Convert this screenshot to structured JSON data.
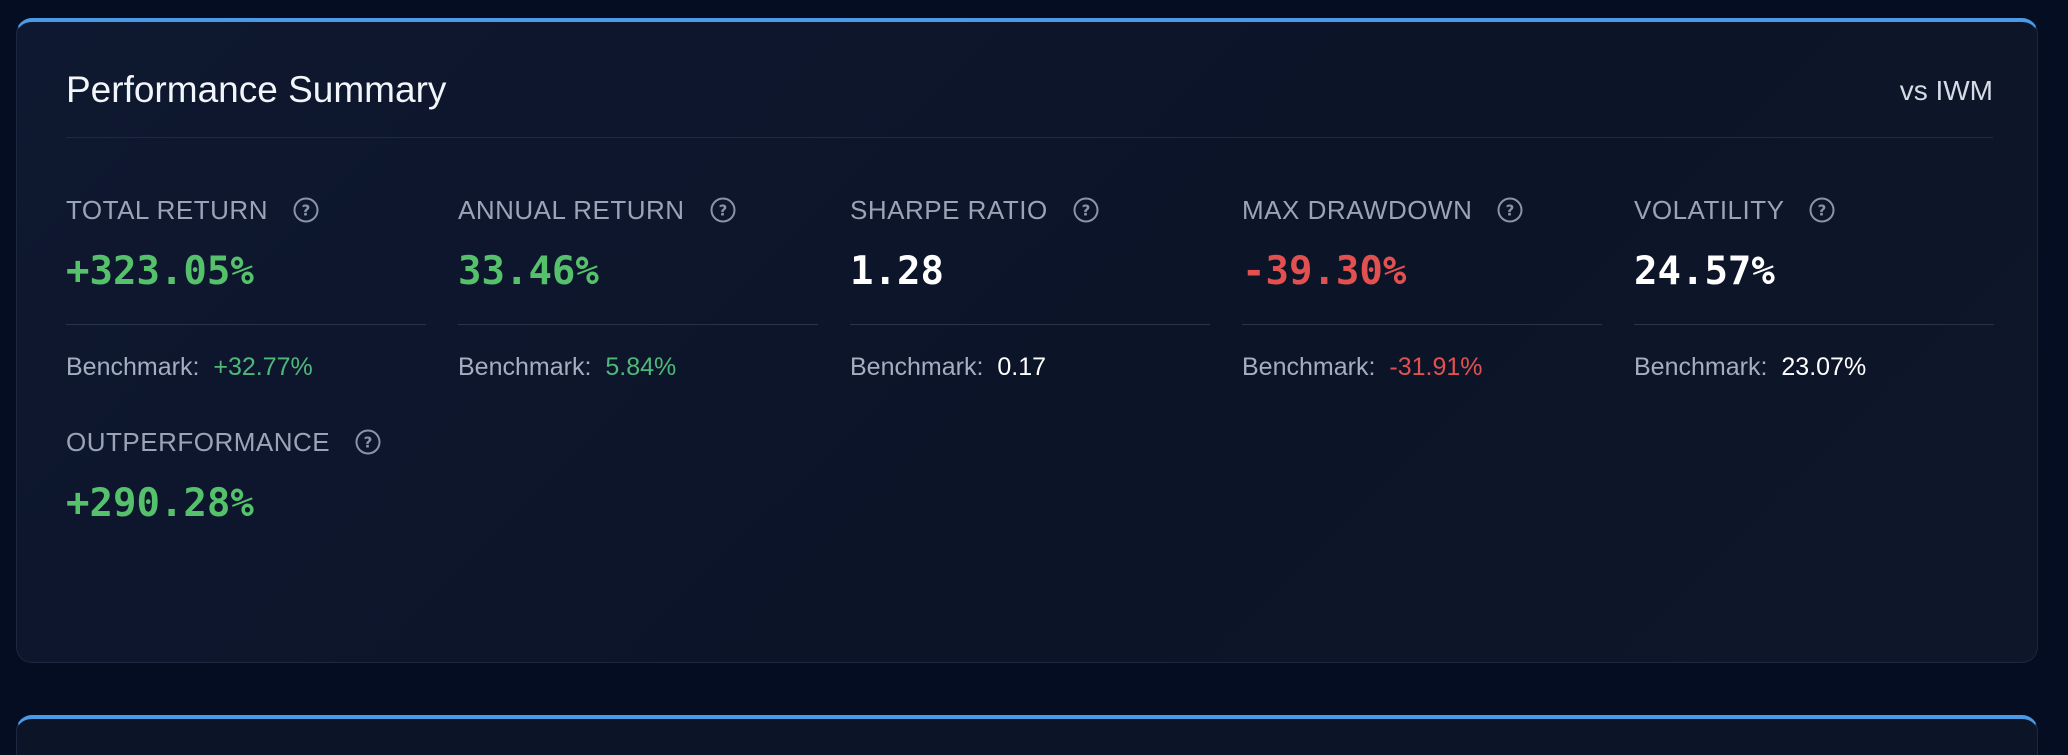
{
  "card": {
    "title": "Performance Summary",
    "subtitle": "vs IWM"
  },
  "metrics": [
    {
      "label": "TOTAL RETURN",
      "value": "+323.05%",
      "benchmark_label": "Benchmark:",
      "benchmark_value": "+32.77%"
    },
    {
      "label": "ANNUAL RETURN",
      "value": "33.46%",
      "benchmark_label": "Benchmark:",
      "benchmark_value": "5.84%"
    },
    {
      "label": "SHARPE RATIO",
      "value": "1.28",
      "benchmark_label": "Benchmark:",
      "benchmark_value": "0.17"
    },
    {
      "label": "MAX DRAWDOWN",
      "value": "-39.30%",
      "benchmark_label": "Benchmark:",
      "benchmark_value": "-31.91%"
    },
    {
      "label": "VOLATILITY",
      "value": "24.57%",
      "benchmark_label": "Benchmark:",
      "benchmark_value": "23.07%"
    },
    {
      "label": "OUTPERFORMANCE",
      "value": "+290.28%"
    }
  ],
  "icons": {
    "help": "question-circle-icon"
  },
  "colors": {
    "accent_border": "#4a9ae8",
    "positive": "#55c16b",
    "negative": "#e2504f",
    "neutral": "#ffffff",
    "background": "#050d22",
    "card": "#0e1830"
  }
}
